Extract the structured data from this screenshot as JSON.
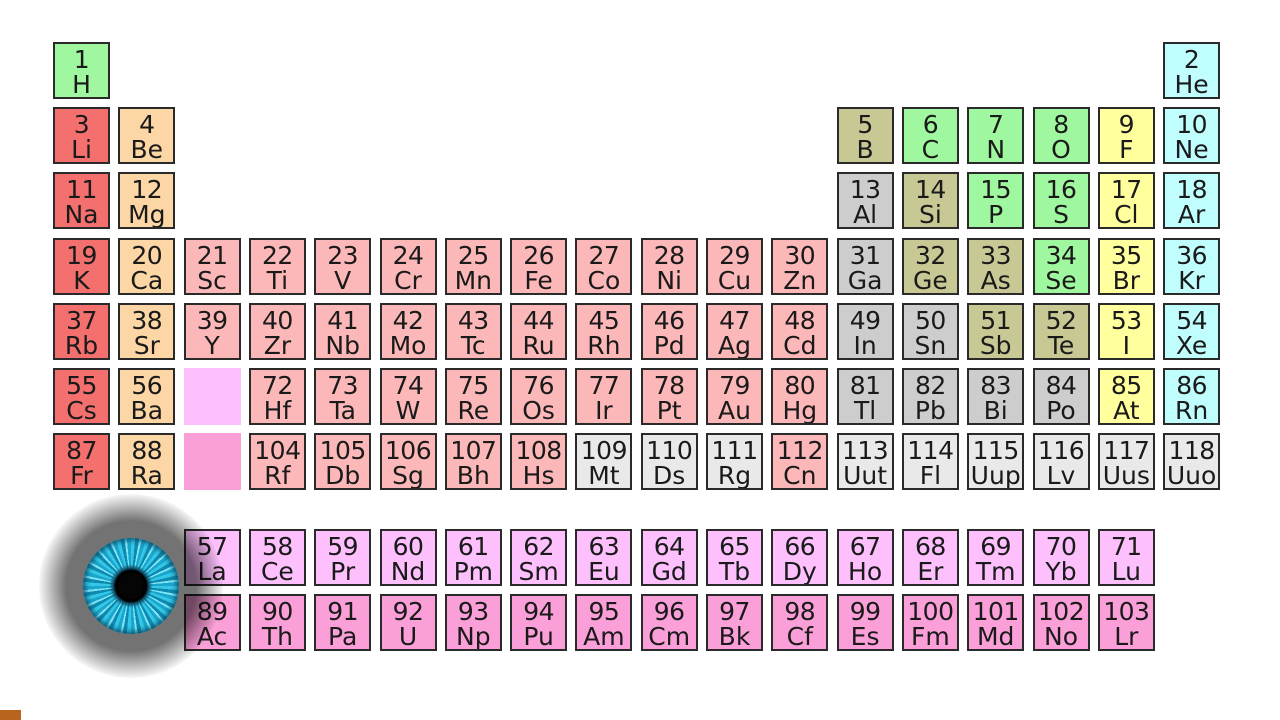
{
  "colors": {
    "alkali": "#f3706e",
    "alkaline_earth": "#fcd6a4",
    "transition": "#fcb8b8",
    "lanthanide": "#fdc0fd",
    "actinide": "#fb9fd8",
    "post_transition": "#cdcdcd",
    "metalloid": "#c8c894",
    "nonmetal": "#9ff89f",
    "halogen": "#ffff9d",
    "noble_gas": "#c0fefe",
    "unknown": "#e9e9e9",
    "lanthanide_placeholder": "#fdc0fd",
    "actinide_placeholder": "#fb9fd8"
  },
  "elements": [
    {
      "n": "1",
      "s": "H",
      "c": "nonmetal",
      "r": 1,
      "g": 1
    },
    {
      "n": "2",
      "s": "He",
      "c": "noble_gas",
      "r": 1,
      "g": 18
    },
    {
      "n": "3",
      "s": "Li",
      "c": "alkali",
      "r": 2,
      "g": 1
    },
    {
      "n": "4",
      "s": "Be",
      "c": "alkaline_earth",
      "r": 2,
      "g": 2
    },
    {
      "n": "5",
      "s": "B",
      "c": "metalloid",
      "r": 2,
      "g": 13
    },
    {
      "n": "6",
      "s": "C",
      "c": "nonmetal",
      "r": 2,
      "g": 14
    },
    {
      "n": "7",
      "s": "N",
      "c": "nonmetal",
      "r": 2,
      "g": 15
    },
    {
      "n": "8",
      "s": "O",
      "c": "nonmetal",
      "r": 2,
      "g": 16
    },
    {
      "n": "9",
      "s": "F",
      "c": "halogen",
      "r": 2,
      "g": 17
    },
    {
      "n": "10",
      "s": "Ne",
      "c": "noble_gas",
      "r": 2,
      "g": 18
    },
    {
      "n": "11",
      "s": "Na",
      "c": "alkali",
      "r": 3,
      "g": 1
    },
    {
      "n": "12",
      "s": "Mg",
      "c": "alkaline_earth",
      "r": 3,
      "g": 2
    },
    {
      "n": "13",
      "s": "Al",
      "c": "post_transition",
      "r": 3,
      "g": 13
    },
    {
      "n": "14",
      "s": "Si",
      "c": "metalloid",
      "r": 3,
      "g": 14
    },
    {
      "n": "15",
      "s": "P",
      "c": "nonmetal",
      "r": 3,
      "g": 15
    },
    {
      "n": "16",
      "s": "S",
      "c": "nonmetal",
      "r": 3,
      "g": 16
    },
    {
      "n": "17",
      "s": "Cl",
      "c": "halogen",
      "r": 3,
      "g": 17
    },
    {
      "n": "18",
      "s": "Ar",
      "c": "noble_gas",
      "r": 3,
      "g": 18
    },
    {
      "n": "19",
      "s": "K",
      "c": "alkali",
      "r": 4,
      "g": 1
    },
    {
      "n": "20",
      "s": "Ca",
      "c": "alkaline_earth",
      "r": 4,
      "g": 2
    },
    {
      "n": "21",
      "s": "Sc",
      "c": "transition",
      "r": 4,
      "g": 3
    },
    {
      "n": "22",
      "s": "Ti",
      "c": "transition",
      "r": 4,
      "g": 4
    },
    {
      "n": "23",
      "s": "V",
      "c": "transition",
      "r": 4,
      "g": 5
    },
    {
      "n": "24",
      "s": "Cr",
      "c": "transition",
      "r": 4,
      "g": 6
    },
    {
      "n": "25",
      "s": "Mn",
      "c": "transition",
      "r": 4,
      "g": 7
    },
    {
      "n": "26",
      "s": "Fe",
      "c": "transition",
      "r": 4,
      "g": 8
    },
    {
      "n": "27",
      "s": "Co",
      "c": "transition",
      "r": 4,
      "g": 9
    },
    {
      "n": "28",
      "s": "Ni",
      "c": "transition",
      "r": 4,
      "g": 10
    },
    {
      "n": "29",
      "s": "Cu",
      "c": "transition",
      "r": 4,
      "g": 11
    },
    {
      "n": "30",
      "s": "Zn",
      "c": "transition",
      "r": 4,
      "g": 12
    },
    {
      "n": "31",
      "s": "Ga",
      "c": "post_transition",
      "r": 4,
      "g": 13
    },
    {
      "n": "32",
      "s": "Ge",
      "c": "metalloid",
      "r": 4,
      "g": 14
    },
    {
      "n": "33",
      "s": "As",
      "c": "metalloid",
      "r": 4,
      "g": 15
    },
    {
      "n": "34",
      "s": "Se",
      "c": "nonmetal",
      "r": 4,
      "g": 16
    },
    {
      "n": "35",
      "s": "Br",
      "c": "halogen",
      "r": 4,
      "g": 17
    },
    {
      "n": "36",
      "s": "Kr",
      "c": "noble_gas",
      "r": 4,
      "g": 18
    },
    {
      "n": "37",
      "s": "Rb",
      "c": "alkali",
      "r": 5,
      "g": 1
    },
    {
      "n": "38",
      "s": "Sr",
      "c": "alkaline_earth",
      "r": 5,
      "g": 2
    },
    {
      "n": "39",
      "s": "Y",
      "c": "transition",
      "r": 5,
      "g": 3
    },
    {
      "n": "40",
      "s": "Zr",
      "c": "transition",
      "r": 5,
      "g": 4
    },
    {
      "n": "41",
      "s": "Nb",
      "c": "transition",
      "r": 5,
      "g": 5
    },
    {
      "n": "42",
      "s": "Mo",
      "c": "transition",
      "r": 5,
      "g": 6
    },
    {
      "n": "43",
      "s": "Tc",
      "c": "transition",
      "r": 5,
      "g": 7
    },
    {
      "n": "44",
      "s": "Ru",
      "c": "transition",
      "r": 5,
      "g": 8
    },
    {
      "n": "45",
      "s": "Rh",
      "c": "transition",
      "r": 5,
      "g": 9
    },
    {
      "n": "46",
      "s": "Pd",
      "c": "transition",
      "r": 5,
      "g": 10
    },
    {
      "n": "47",
      "s": "Ag",
      "c": "transition",
      "r": 5,
      "g": 11
    },
    {
      "n": "48",
      "s": "Cd",
      "c": "transition",
      "r": 5,
      "g": 12
    },
    {
      "n": "49",
      "s": "In",
      "c": "post_transition",
      "r": 5,
      "g": 13
    },
    {
      "n": "50",
      "s": "Sn",
      "c": "post_transition",
      "r": 5,
      "g": 14
    },
    {
      "n": "51",
      "s": "Sb",
      "c": "metalloid",
      "r": 5,
      "g": 15
    },
    {
      "n": "52",
      "s": "Te",
      "c": "metalloid",
      "r": 5,
      "g": 16
    },
    {
      "n": "53",
      "s": "I",
      "c": "halogen",
      "r": 5,
      "g": 17
    },
    {
      "n": "54",
      "s": "Xe",
      "c": "noble_gas",
      "r": 5,
      "g": 18
    },
    {
      "n": "55",
      "s": "Cs",
      "c": "alkali",
      "r": 6,
      "g": 1
    },
    {
      "n": "56",
      "s": "Ba",
      "c": "alkaline_earth",
      "r": 6,
      "g": 2
    },
    {
      "n": "",
      "s": "",
      "c": "lanthanide_placeholder",
      "r": 6,
      "g": 3,
      "empty": true
    },
    {
      "n": "72",
      "s": "Hf",
      "c": "transition",
      "r": 6,
      "g": 4
    },
    {
      "n": "73",
      "s": "Ta",
      "c": "transition",
      "r": 6,
      "g": 5
    },
    {
      "n": "74",
      "s": "W",
      "c": "transition",
      "r": 6,
      "g": 6
    },
    {
      "n": "75",
      "s": "Re",
      "c": "transition",
      "r": 6,
      "g": 7
    },
    {
      "n": "76",
      "s": "Os",
      "c": "transition",
      "r": 6,
      "g": 8
    },
    {
      "n": "77",
      "s": "Ir",
      "c": "transition",
      "r": 6,
      "g": 9
    },
    {
      "n": "78",
      "s": "Pt",
      "c": "transition",
      "r": 6,
      "g": 10
    },
    {
      "n": "79",
      "s": "Au",
      "c": "transition",
      "r": 6,
      "g": 11
    },
    {
      "n": "80",
      "s": "Hg",
      "c": "transition",
      "r": 6,
      "g": 12
    },
    {
      "n": "81",
      "s": "Tl",
      "c": "post_transition",
      "r": 6,
      "g": 13
    },
    {
      "n": "82",
      "s": "Pb",
      "c": "post_transition",
      "r": 6,
      "g": 14
    },
    {
      "n": "83",
      "s": "Bi",
      "c": "post_transition",
      "r": 6,
      "g": 15
    },
    {
      "n": "84",
      "s": "Po",
      "c": "post_transition",
      "r": 6,
      "g": 16
    },
    {
      "n": "85",
      "s": "At",
      "c": "halogen",
      "r": 6,
      "g": 17
    },
    {
      "n": "86",
      "s": "Rn",
      "c": "noble_gas",
      "r": 6,
      "g": 18
    },
    {
      "n": "87",
      "s": "Fr",
      "c": "alkali",
      "r": 7,
      "g": 1
    },
    {
      "n": "88",
      "s": "Ra",
      "c": "alkaline_earth",
      "r": 7,
      "g": 2
    },
    {
      "n": "",
      "s": "",
      "c": "actinide_placeholder",
      "r": 7,
      "g": 3,
      "empty": true
    },
    {
      "n": "104",
      "s": "Rf",
      "c": "transition",
      "r": 7,
      "g": 4
    },
    {
      "n": "105",
      "s": "Db",
      "c": "transition",
      "r": 7,
      "g": 5
    },
    {
      "n": "106",
      "s": "Sg",
      "c": "transition",
      "r": 7,
      "g": 6
    },
    {
      "n": "107",
      "s": "Bh",
      "c": "transition",
      "r": 7,
      "g": 7
    },
    {
      "n": "108",
      "s": "Hs",
      "c": "transition",
      "r": 7,
      "g": 8
    },
    {
      "n": "109",
      "s": "Mt",
      "c": "unknown",
      "r": 7,
      "g": 9
    },
    {
      "n": "110",
      "s": "Ds",
      "c": "unknown",
      "r": 7,
      "g": 10
    },
    {
      "n": "111",
      "s": "Rg",
      "c": "unknown",
      "r": 7,
      "g": 11
    },
    {
      "n": "112",
      "s": "Cn",
      "c": "transition",
      "r": 7,
      "g": 12
    },
    {
      "n": "113",
      "s": "Uut",
      "c": "unknown",
      "r": 7,
      "g": 13
    },
    {
      "n": "114",
      "s": "Fl",
      "c": "unknown",
      "r": 7,
      "g": 14
    },
    {
      "n": "115",
      "s": "Uup",
      "c": "unknown",
      "r": 7,
      "g": 15
    },
    {
      "n": "116",
      "s": "Lv",
      "c": "unknown",
      "r": 7,
      "g": 16
    },
    {
      "n": "117",
      "s": "Uus",
      "c": "unknown",
      "r": 7,
      "g": 17
    },
    {
      "n": "118",
      "s": "Uuo",
      "c": "unknown",
      "r": 7,
      "g": 18
    },
    {
      "n": "57",
      "s": "La",
      "c": "lanthanide",
      "r": 9,
      "g": 3
    },
    {
      "n": "58",
      "s": "Ce",
      "c": "lanthanide",
      "r": 9,
      "g": 4
    },
    {
      "n": "59",
      "s": "Pr",
      "c": "lanthanide",
      "r": 9,
      "g": 5
    },
    {
      "n": "60",
      "s": "Nd",
      "c": "lanthanide",
      "r": 9,
      "g": 6
    },
    {
      "n": "61",
      "s": "Pm",
      "c": "lanthanide",
      "r": 9,
      "g": 7
    },
    {
      "n": "62",
      "s": "Sm",
      "c": "lanthanide",
      "r": 9,
      "g": 8
    },
    {
      "n": "63",
      "s": "Eu",
      "c": "lanthanide",
      "r": 9,
      "g": 9
    },
    {
      "n": "64",
      "s": "Gd",
      "c": "lanthanide",
      "r": 9,
      "g": 10
    },
    {
      "n": "65",
      "s": "Tb",
      "c": "lanthanide",
      "r": 9,
      "g": 11
    },
    {
      "n": "66",
      "s": "Dy",
      "c": "lanthanide",
      "r": 9,
      "g": 12
    },
    {
      "n": "67",
      "s": "Ho",
      "c": "lanthanide",
      "r": 9,
      "g": 13
    },
    {
      "n": "68",
      "s": "Er",
      "c": "lanthanide",
      "r": 9,
      "g": 14
    },
    {
      "n": "69",
      "s": "Tm",
      "c": "lanthanide",
      "r": 9,
      "g": 15
    },
    {
      "n": "70",
      "s": "Yb",
      "c": "lanthanide",
      "r": 9,
      "g": 16
    },
    {
      "n": "71",
      "s": "Lu",
      "c": "lanthanide",
      "r": 9,
      "g": 17
    },
    {
      "n": "89",
      "s": "Ac",
      "c": "actinide",
      "r": 10,
      "g": 3
    },
    {
      "n": "90",
      "s": "Th",
      "c": "actinide",
      "r": 10,
      "g": 4
    },
    {
      "n": "91",
      "s": "Pa",
      "c": "actinide",
      "r": 10,
      "g": 5
    },
    {
      "n": "92",
      "s": "U",
      "c": "actinide",
      "r": 10,
      "g": 6
    },
    {
      "n": "93",
      "s": "Np",
      "c": "actinide",
      "r": 10,
      "g": 7
    },
    {
      "n": "94",
      "s": "Pu",
      "c": "actinide",
      "r": 10,
      "g": 8
    },
    {
      "n": "95",
      "s": "Am",
      "c": "actinide",
      "r": 10,
      "g": 9
    },
    {
      "n": "96",
      "s": "Cm",
      "c": "actinide",
      "r": 10,
      "g": 10
    },
    {
      "n": "97",
      "s": "Bk",
      "c": "actinide",
      "r": 10,
      "g": 11
    },
    {
      "n": "98",
      "s": "Cf",
      "c": "actinide",
      "r": 10,
      "g": 12
    },
    {
      "n": "99",
      "s": "Es",
      "c": "actinide",
      "r": 10,
      "g": 13
    },
    {
      "n": "100",
      "s": "Fm",
      "c": "actinide",
      "r": 10,
      "g": 14
    },
    {
      "n": "101",
      "s": "Md",
      "c": "actinide",
      "r": 10,
      "g": 15
    },
    {
      "n": "102",
      "s": "No",
      "c": "actinide",
      "r": 10,
      "g": 16
    },
    {
      "n": "103",
      "s": "Lr",
      "c": "actinide",
      "r": 10,
      "g": 17
    }
  ]
}
